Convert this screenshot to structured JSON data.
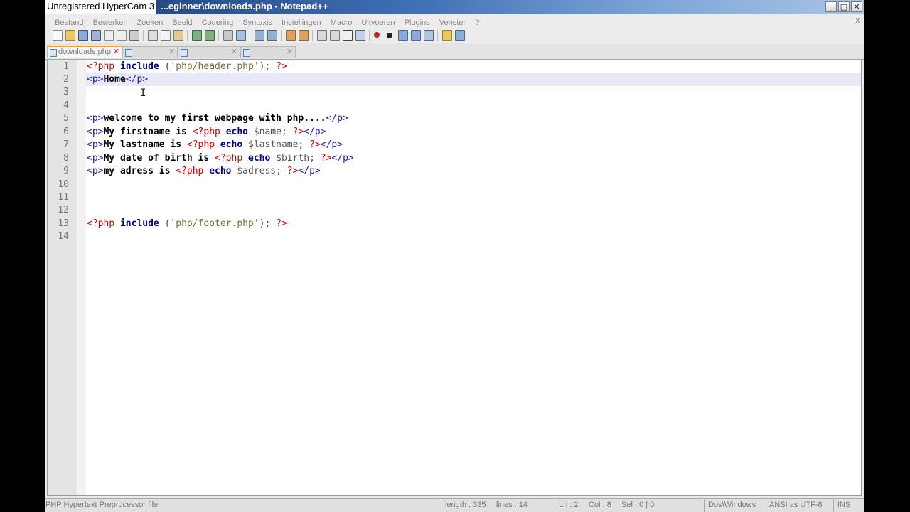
{
  "watermark": "Unregistered HyperCam 3",
  "window": {
    "title": "...eginner\\downloads.php - Notepad++"
  },
  "menu": [
    "Bestand",
    "Bewerken",
    "Zoeken",
    "Beeld",
    "Codering",
    "Syntaxis",
    "Instellingen",
    "Macro",
    "Uitvoeren",
    "Plugins",
    "Venster",
    "?"
  ],
  "menu_close": "X",
  "tabs": [
    {
      "label": "downloads.php",
      "active": true
    },
    {
      "label": "",
      "active": false
    },
    {
      "label": "",
      "active": false
    },
    {
      "label": "",
      "active": false
    }
  ],
  "editor": {
    "line_numbers": [
      "1",
      "2",
      "3",
      "4",
      "5",
      "6",
      "7",
      "8",
      "9",
      "10",
      "11",
      "12",
      "13",
      "14"
    ],
    "current_line": 2
  },
  "status": {
    "file_type": "PHP Hypertext Preprocessor file",
    "length": "length : 335",
    "lines": "lines : 14",
    "ln": "Ln : 2",
    "col": "Col : 8",
    "sel": "Sel : 0 | 0",
    "eol": "Dos\\Windows",
    "encoding": "ANSI as UTF-8",
    "mode": "INS"
  },
  "colors": {
    "php_delim": "#d20000",
    "keyword": "#00008c",
    "string": "#7a6a3a",
    "tag": "#2222aa",
    "current_line": "#e8e8f8"
  }
}
